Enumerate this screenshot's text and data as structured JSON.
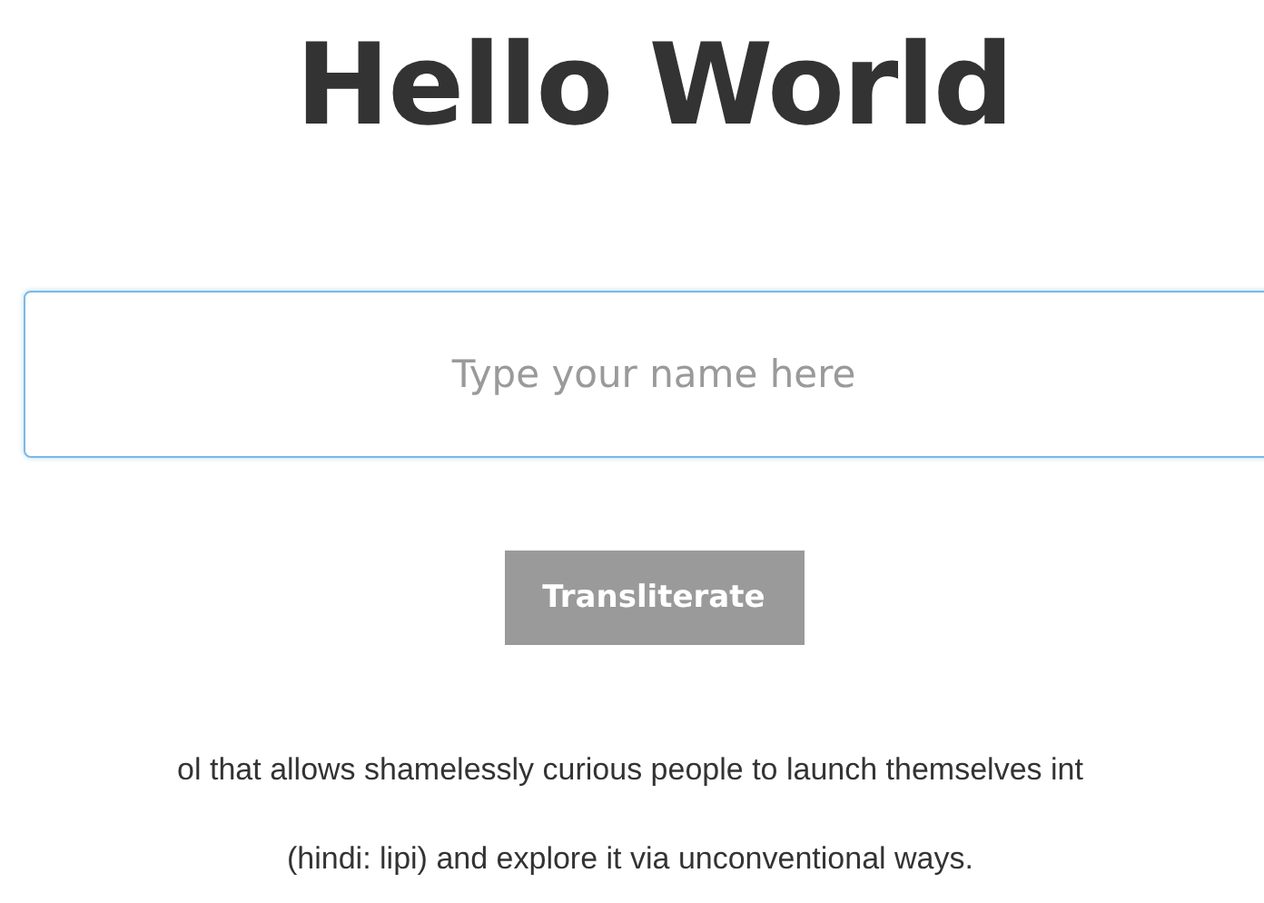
{
  "heading": "Hello World",
  "name_field": {
    "placeholder": "Type your name here"
  },
  "button": "Transliterate",
  "description_lines": [
    "ol that allows shamelessly curious people to launch themselves int",
    "(hindi: lipi) and explore it via unconventional ways."
  ]
}
